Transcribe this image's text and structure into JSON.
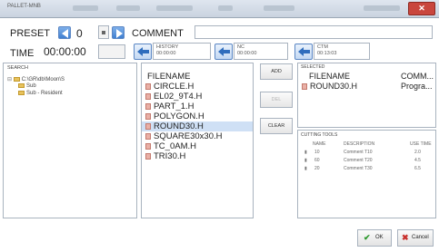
{
  "window": {
    "title": "PALLET-MNB",
    "close_glyph": "✕"
  },
  "preset": {
    "label": "PRESET",
    "value": "0",
    "prev_icon": "arrow-left-icon",
    "next_icon": "arrow-right-icon"
  },
  "comment": {
    "label": "COMMENT",
    "value": ""
  },
  "time": {
    "label": "TIME",
    "value": "00:00:00"
  },
  "history": {
    "label": "HISTORY",
    "value": "00:00:00"
  },
  "nc": {
    "label": "NC",
    "value": "00:00:00"
  },
  "ctm": {
    "label": "CTM",
    "value": "00:13:03"
  },
  "search": {
    "label": "SEARCH",
    "tree": [
      {
        "label": "C:\\GR\\db\\Moon\\S"
      },
      {
        "label": "Sub"
      },
      {
        "label": "Sub - Resident"
      }
    ]
  },
  "files": {
    "header": "FILENAME",
    "items": [
      "CIRCLE.H",
      "EL02_9T4.H",
      "PART_1.H",
      "POLYGON.H",
      "ROUND30.H",
      "SQUARE30x30.H",
      "TC_0AM.H",
      "TRI30.H"
    ],
    "selected_index": 4
  },
  "actions": {
    "add": "ADD",
    "del": "DEL",
    "clear": "CLEAR"
  },
  "selected": {
    "title": "SELECTED",
    "col_filename": "FILENAME",
    "col_comment": "COMM...",
    "rows": [
      {
        "filename": "ROUND30.H",
        "comment": "Progra..."
      }
    ]
  },
  "cutting_tools": {
    "title": "CUTTING TOOLS",
    "headers": [
      "NAME",
      "DESCRIPTION",
      "USE TIME"
    ],
    "rows": [
      {
        "name": "10",
        "description": "Comment T10",
        "use_time": "2.0"
      },
      {
        "name": "60",
        "description": "Comment T20",
        "use_time": "4.5"
      },
      {
        "name": "20",
        "description": "Comment T30",
        "use_time": "6.5"
      }
    ]
  },
  "footer": {
    "ok": "OK",
    "cancel": "Cancel"
  },
  "colors": {
    "accent": "#3f7fd0",
    "selection": "#cfe0f5",
    "ok_check": "#2e9a2e",
    "cancel_x": "#c9302c"
  }
}
